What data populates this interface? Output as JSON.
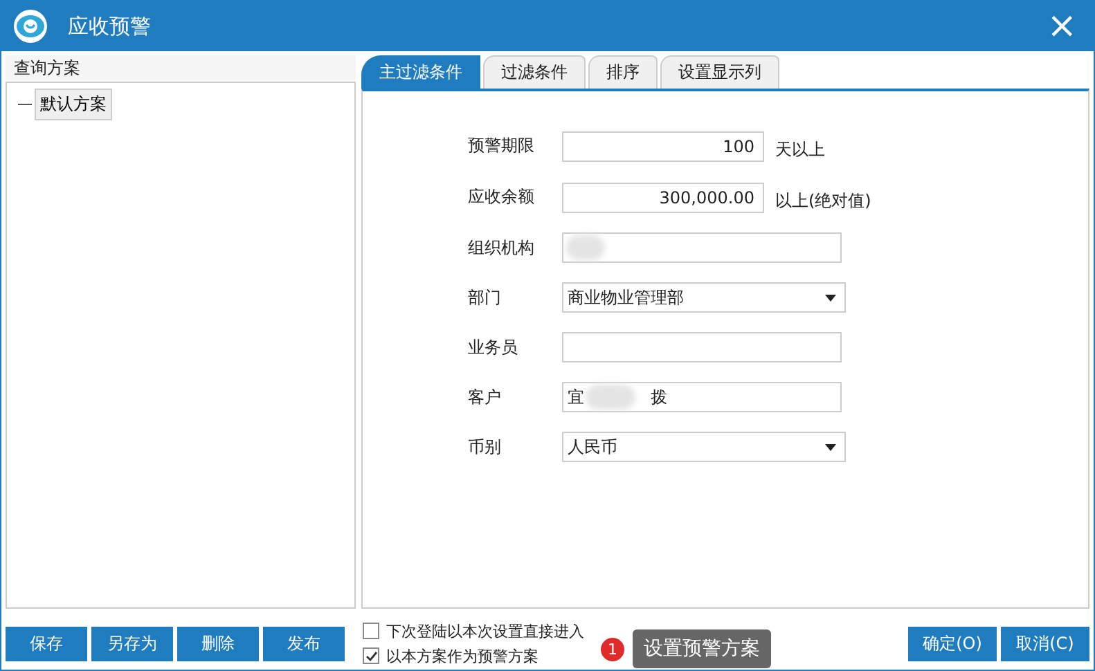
{
  "window": {
    "title": "应收预警",
    "close": "×"
  },
  "sidebar": {
    "title": "查询方案",
    "tree": [
      {
        "label": "默认方案",
        "expanded": true,
        "selected": true
      }
    ]
  },
  "tabs": [
    {
      "label": "主过滤条件",
      "selected": true
    },
    {
      "label": "过滤条件",
      "selected": false
    },
    {
      "label": "排序",
      "selected": false
    },
    {
      "label": "设置显示列",
      "selected": false
    }
  ],
  "fields": [
    {
      "label": "预警期限",
      "kind": "number",
      "value": "100",
      "suffix": "天以上"
    },
    {
      "label": "应收余额",
      "kind": "number",
      "value": "300,000.00",
      "suffix": "以上(绝对值)"
    },
    {
      "label": "组织机构",
      "kind": "text",
      "blurred": true
    },
    {
      "label": "部门",
      "kind": "select",
      "value": "商业物业管理部"
    },
    {
      "label": "业务员",
      "kind": "text"
    },
    {
      "label": "客户",
      "kind": "text",
      "value": "宜　　　　拨",
      "blurred": true
    },
    {
      "label": "币别",
      "kind": "select",
      "value": "人民币"
    }
  ],
  "scheme_buttons": [
    "保存",
    "另存为",
    "删除",
    "发布"
  ],
  "options": [
    {
      "label": "下次登陆以本次设置直接进入",
      "checked": false
    },
    {
      "label": "以本方案作为预警方案",
      "checked": true
    }
  ],
  "tooltip": {
    "badge": "1",
    "text": "设置预警方案"
  },
  "dialog_buttons": [
    "确定(O)",
    "取消(C)"
  ]
}
